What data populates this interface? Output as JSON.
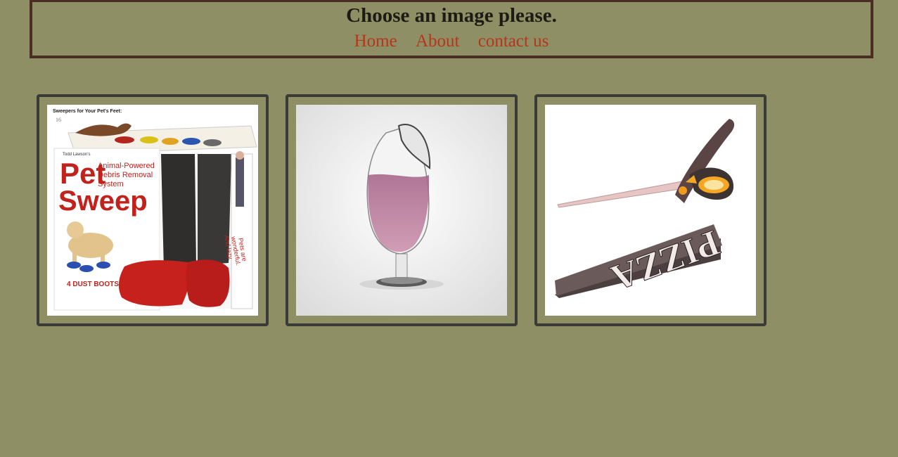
{
  "header": {
    "title": "Choose an image please."
  },
  "nav": {
    "items": [
      {
        "label": "Home"
      },
      {
        "label": "About"
      },
      {
        "label": "contact us"
      }
    ]
  },
  "gallery": {
    "images": [
      {
        "icon": "pet-sweep-box-image",
        "caption": "Sweepers for Your Pet's Feet:",
        "page_number": "16",
        "brand_small": "Todd Lawson's",
        "brand_big_1": "Pet",
        "brand_big_2": "Sweep",
        "subtitle_1": "Animal-Powered",
        "subtitle_2": "Debris Removal",
        "subtitle_3": "System",
        "boots_label": "4 DUST BOOTS",
        "side_text_1": "Pets are",
        "side_text_2": "wonderful.",
        "side_text_3": "And lazy."
      },
      {
        "icon": "wine-glass-image"
      },
      {
        "icon": "pizza-scissors-image",
        "label": "PIZZA"
      }
    ]
  }
}
